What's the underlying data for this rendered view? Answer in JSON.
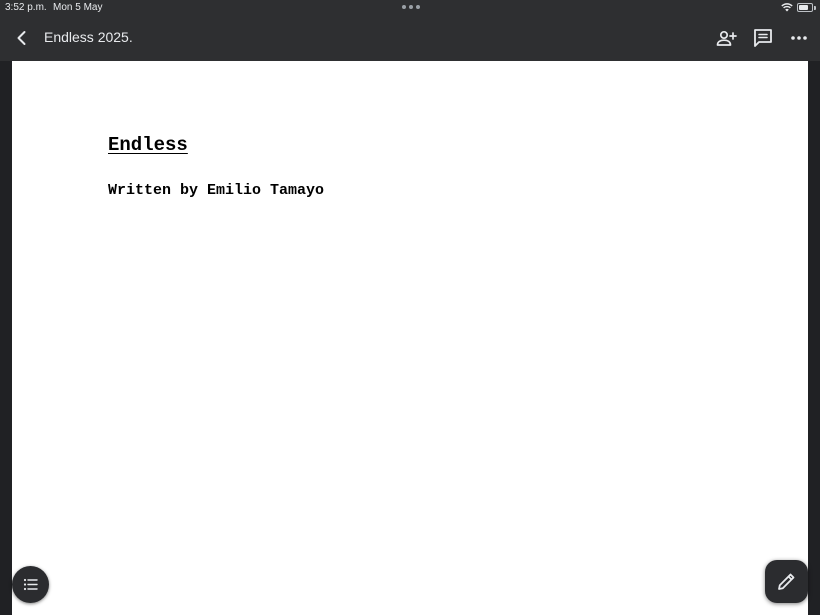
{
  "status_bar": {
    "time": "3:52 p.m.",
    "date": "Mon 5 May"
  },
  "toolbar": {
    "title": "Endless 2025.",
    "icons": {
      "back": "chevron-left-icon",
      "share": "person-add-icon",
      "comments": "comment-icon",
      "more": "more-horiz-icon"
    }
  },
  "document": {
    "title": "Endless",
    "byline": "Written by Emilio Tamayo"
  },
  "fabs": {
    "outline": "list-icon",
    "edit": "pencil-icon"
  },
  "colors": {
    "chrome": "#2e2f31",
    "background": "#202124",
    "page": "#ffffff",
    "text": "#000000"
  }
}
